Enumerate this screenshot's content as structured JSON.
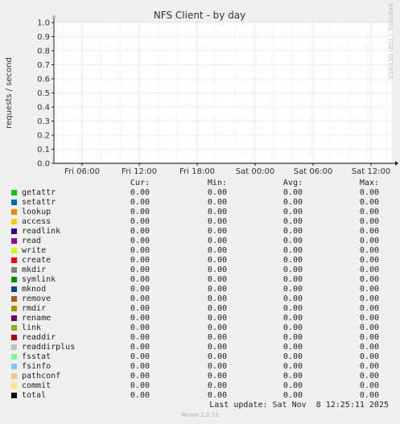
{
  "chart_data": {
    "type": "line",
    "title": "NFS Client - by day",
    "ylabel": "requests / second",
    "xlabel": "",
    "ylim": [
      0,
      1.0
    ],
    "y_ticks": [
      "0.0",
      "0.1",
      "0.2",
      "0.3",
      "0.4",
      "0.5",
      "0.6",
      "0.7",
      "0.8",
      "0.9",
      "1.0"
    ],
    "x_ticks": [
      "Fri 06:00",
      "Fri 12:00",
      "Fri 18:00",
      "Sat 00:00",
      "Sat 06:00",
      "Sat 12:00"
    ],
    "grid": true,
    "legend_headers": [
      "Cur:",
      "Min:",
      "Avg:",
      "Max:"
    ],
    "series": [
      {
        "name": "getattr",
        "color": "#00cc00",
        "cur": "0.00",
        "min": "0.00",
        "avg": "0.00",
        "max": "0.00"
      },
      {
        "name": "setattr",
        "color": "#0066b3",
        "cur": "0.00",
        "min": "0.00",
        "avg": "0.00",
        "max": "0.00"
      },
      {
        "name": "lookup",
        "color": "#ff8000",
        "cur": "0.00",
        "min": "0.00",
        "avg": "0.00",
        "max": "0.00"
      },
      {
        "name": "access",
        "color": "#ffcc00",
        "cur": "0.00",
        "min": "0.00",
        "avg": "0.00",
        "max": "0.00"
      },
      {
        "name": "readlink",
        "color": "#330099",
        "cur": "0.00",
        "min": "0.00",
        "avg": "0.00",
        "max": "0.00"
      },
      {
        "name": "read",
        "color": "#990099",
        "cur": "0.00",
        "min": "0.00",
        "avg": "0.00",
        "max": "0.00"
      },
      {
        "name": "write",
        "color": "#ccff00",
        "cur": "0.00",
        "min": "0.00",
        "avg": "0.00",
        "max": "0.00"
      },
      {
        "name": "create",
        "color": "#ff0000",
        "cur": "0.00",
        "min": "0.00",
        "avg": "0.00",
        "max": "0.00"
      },
      {
        "name": "mkdir",
        "color": "#808080",
        "cur": "0.00",
        "min": "0.00",
        "avg": "0.00",
        "max": "0.00"
      },
      {
        "name": "symlink",
        "color": "#008f00",
        "cur": "0.00",
        "min": "0.00",
        "avg": "0.00",
        "max": "0.00"
      },
      {
        "name": "mknod",
        "color": "#00487d",
        "cur": "0.00",
        "min": "0.00",
        "avg": "0.00",
        "max": "0.00"
      },
      {
        "name": "remove",
        "color": "#b35a00",
        "cur": "0.00",
        "min": "0.00",
        "avg": "0.00",
        "max": "0.00"
      },
      {
        "name": "rmdir",
        "color": "#b38f00",
        "cur": "0.00",
        "min": "0.00",
        "avg": "0.00",
        "max": "0.00"
      },
      {
        "name": "rename",
        "color": "#6b006b",
        "cur": "0.00",
        "min": "0.00",
        "avg": "0.00",
        "max": "0.00"
      },
      {
        "name": "link",
        "color": "#8fb300",
        "cur": "0.00",
        "min": "0.00",
        "avg": "0.00",
        "max": "0.00"
      },
      {
        "name": "readdir",
        "color": "#b30000",
        "cur": "0.00",
        "min": "0.00",
        "avg": "0.00",
        "max": "0.00"
      },
      {
        "name": "readdirplus",
        "color": "#bebebe",
        "cur": "0.00",
        "min": "0.00",
        "avg": "0.00",
        "max": "0.00"
      },
      {
        "name": "fsstat",
        "color": "#80ff80",
        "cur": "0.00",
        "min": "0.00",
        "avg": "0.00",
        "max": "0.00"
      },
      {
        "name": "fsinfo",
        "color": "#80c9ff",
        "cur": "0.00",
        "min": "0.00",
        "avg": "0.00",
        "max": "0.00"
      },
      {
        "name": "pathconf",
        "color": "#ffc080",
        "cur": "0.00",
        "min": "0.00",
        "avg": "0.00",
        "max": "0.00"
      },
      {
        "name": "commit",
        "color": "#ffe680",
        "cur": "0.00",
        "min": "0.00",
        "avg": "0.00",
        "max": "0.00"
      },
      {
        "name": "total",
        "color": "#000000",
        "cur": "0.00",
        "min": "0.00",
        "avg": "0.00",
        "max": "0.00"
      }
    ],
    "last_update": "Last update: Sat Nov  8 12:25:11 2025",
    "footer": "Munin 2.0.73",
    "watermark": "RRDTOOL / TOBI OETIKER"
  },
  "colors": {
    "background": "#f0f0f0",
    "plot_bg": "#ffffff",
    "major_grid": "#ff9999",
    "axis": "#222222"
  }
}
